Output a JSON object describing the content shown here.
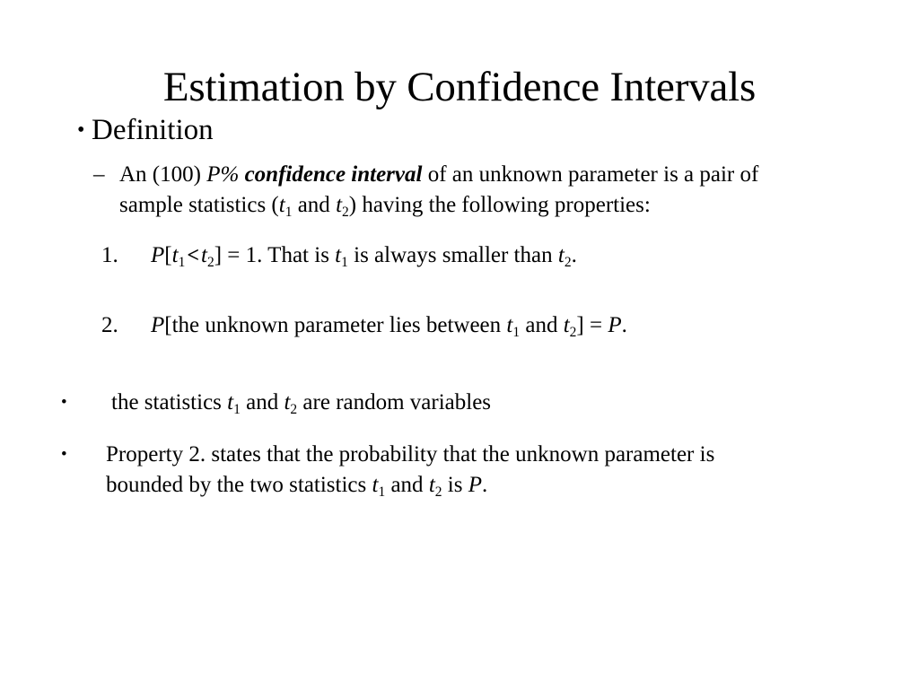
{
  "slide": {
    "title": "Estimation by Confidence Intervals",
    "background_color": "#ffffff",
    "text_color": "#000000",
    "bullet_glyph": "•",
    "dash_glyph": "–",
    "definition": {
      "heading": "Definition",
      "detail": {
        "prefix": "An (100) ",
        "italic_term": "P%",
        "bold_italic_term": "confidence interval",
        "middle": " of an unknown parameter is a pair of sample statistics (",
        "stat_one_base": "t",
        "stat_one_sub": "1",
        "conjunction": " and ",
        "stat_two_base": "t",
        "stat_two_sub": "2",
        "suffix": ") having the following properties:",
        "full_text": "An (100) P% confidence interval of an unknown parameter is a pair of sample statistics (t1 and t2) having the following properties:"
      },
      "properties": [
        {
          "number": "1.",
          "p_symbol": "P",
          "open_bracket": "[",
          "lhs_base": "t",
          "lhs_sub": "1",
          "relation": "<",
          "rhs_base": "t",
          "rhs_sub": "2",
          "close_bracket": "]",
          "equals": " = 1. That is ",
          "tail_base": "t",
          "tail_sub": "1",
          "tail_mid": " is always smaller than ",
          "end_base": "t",
          "end_sub": "2",
          "period": ".",
          "full_text": "P[t1 < t2] = 1. That is t1 is always smaller than t2."
        },
        {
          "number": "2.",
          "p_symbol": "P",
          "open_bracket": "[",
          "phrase": "the unknown parameter lies between ",
          "lhs_base": "t",
          "lhs_sub": "1",
          "conjunction": " and ",
          "rhs_base": "t",
          "rhs_sub": "2",
          "close_bracket": "]",
          "equals": " = ",
          "result": "P",
          "period": ".",
          "full_text": "P[the unknown parameter lies between t1 and t2] = P."
        }
      ]
    },
    "notes": [
      {
        "prefix": "the statistics ",
        "stat_one_base": "t",
        "stat_one_sub": "1",
        "conjunction": " and ",
        "stat_two_base": "t",
        "stat_two_sub": "2",
        "suffix": " are random variables",
        "full_text": "the statistics t1 and t2 are random variables"
      },
      {
        "prefix": "Property 2. states that the probability that the unknown parameter is bounded by the two statistics ",
        "stat_one_base": "t",
        "stat_one_sub": "1",
        "conjunction": " and ",
        "stat_two_base": "t",
        "stat_two_sub": "2",
        "middle": " is ",
        "result": "P",
        "suffix": ".",
        "full_text": "Property 2. states that the probability that the unknown parameter is bounded by the two statistics t1 and t2 is P."
      }
    ]
  }
}
